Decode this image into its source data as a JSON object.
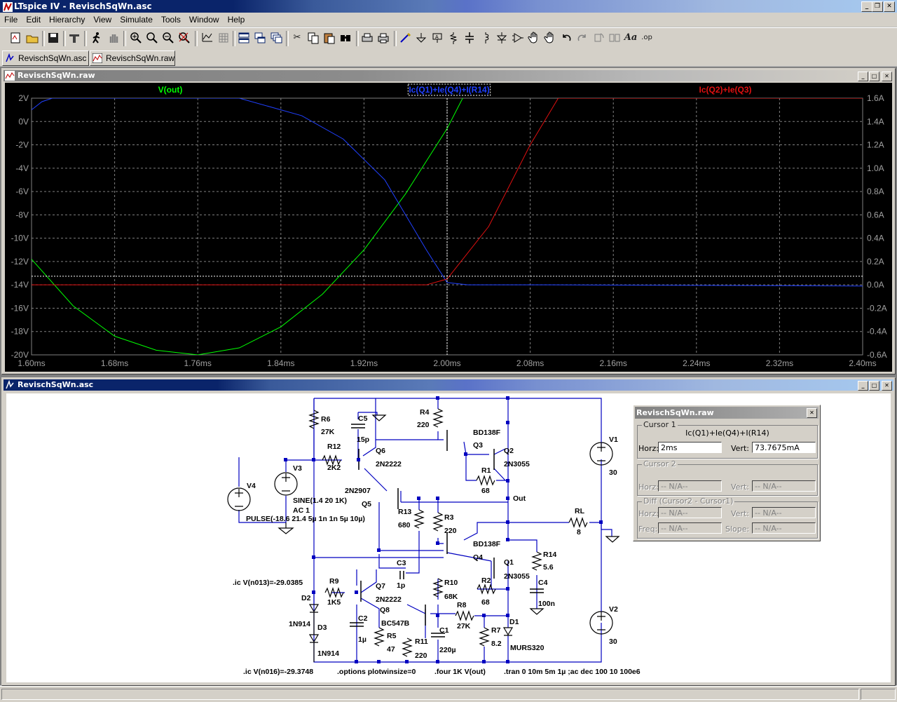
{
  "app": {
    "title": "LTspice IV - RevischSqWn.asc"
  },
  "menu": [
    "File",
    "Edit",
    "Hierarchy",
    "View",
    "Simulate",
    "Tools",
    "Window",
    "Help"
  ],
  "tabs": [
    {
      "label": "RevischSqWn.asc"
    },
    {
      "label": "RevischSqWn.raw"
    }
  ],
  "waveform_window": {
    "title": "RevischSqWn.raw"
  },
  "schematic_window": {
    "title": "RevischSqWn.asc"
  },
  "toolbar_icons": [
    "new-schematic-icon",
    "open-icon",
    "save-icon",
    "control-panel-icon",
    "run-icon",
    "halt-icon",
    "zoom-in-icon",
    "zoom-pan-icon",
    "zoom-out-icon",
    "zoom-fit-icon",
    "autorange-icon",
    "grid-icon",
    "tile-horizontal-icon",
    "tile-vertical-icon",
    "cascade-icon",
    "cut-icon",
    "copy-icon",
    "paste-icon",
    "find-icon",
    "print-setup-icon",
    "print-icon",
    "draw-wire-icon",
    "ground-icon",
    "label-net-icon",
    "resistor-icon",
    "capacitor-icon",
    "inductor-icon",
    "diode-icon",
    "component-icon",
    "move-icon",
    "drag-icon",
    "undo-icon",
    "redo-icon",
    "rotate-icon",
    "mirror-icon",
    "text-icon",
    "spice-directive-icon"
  ],
  "chart_data": {
    "type": "line",
    "x": [
      1.6,
      1.65,
      1.7,
      1.75,
      1.8,
      1.85,
      1.9,
      1.95,
      2.0,
      2.05,
      2.1,
      2.15,
      2.2,
      2.25,
      2.3,
      2.35,
      2.4
    ],
    "x_tick_labels": [
      "1.60ms",
      "1.68ms",
      "1.76ms",
      "1.84ms",
      "1.92ms",
      "2.00ms",
      "2.08ms",
      "2.16ms",
      "2.24ms",
      "2.32ms",
      "2.40ms"
    ],
    "left_axis": {
      "ylim": [
        -20,
        2
      ],
      "tick_labels": [
        "2V",
        "0V",
        "-2V",
        "-4V",
        "-6V",
        "-8V",
        "-10V",
        "-12V",
        "-14V",
        "-16V",
        "-18V",
        "-20V"
      ]
    },
    "right_axis": {
      "ylim": [
        -0.6,
        1.6
      ],
      "tick_labels": [
        "1.6A",
        "1.4A",
        "1.2A",
        "1.0A",
        "0.8A",
        "0.6A",
        "0.4A",
        "0.2A",
        "0.0A",
        "-0.2A",
        "-0.4A",
        "-0.6A"
      ]
    },
    "series": [
      {
        "name": "V(out)",
        "axis": "left",
        "color": "#00ff00",
        "x": [
          1.6,
          1.64,
          1.68,
          1.72,
          1.76,
          1.8,
          1.84,
          1.88,
          1.92,
          1.96,
          2.0,
          2.015
        ],
        "y": [
          -11.8,
          -15.8,
          -18.4,
          -19.6,
          -20.0,
          -19.4,
          -17.6,
          -14.8,
          -11.0,
          -6.2,
          -0.6,
          2.0
        ]
      },
      {
        "name": "Ic(Q1)+Ie(Q4)+I(R14)",
        "axis": "right",
        "color": "#2040ff",
        "x": [
          1.6,
          1.61,
          1.62,
          1.8,
          1.86,
          1.9,
          1.94,
          1.98,
          2.0,
          2.02,
          2.1,
          2.4
        ],
        "y": [
          1.5,
          1.57,
          1.6,
          1.6,
          1.45,
          1.25,
          0.9,
          0.3,
          0.02,
          0.0,
          0.0,
          -0.01
        ]
      },
      {
        "name": "Ic(Q2)+Ie(Q3)",
        "axis": "right",
        "color": "#e01010",
        "x": [
          1.6,
          1.9,
          1.98,
          2.0,
          2.04,
          2.08,
          2.107,
          2.4
        ],
        "y": [
          0.0,
          0.0,
          0.0,
          0.05,
          0.5,
          1.2,
          1.6,
          1.6
        ]
      }
    ],
    "cursor": {
      "x": 2.0,
      "y": 0.0737675
    }
  },
  "cursor_panel": {
    "title": "RevischSqWn.raw",
    "cursor1": {
      "label": "Cursor 1",
      "trace": "Ic(Q1)+Ie(Q4)+I(R14)",
      "horz_label": "Horz:",
      "horz": "2ms",
      "vert_label": "Vert:",
      "vert": "73.7675mA"
    },
    "cursor2": {
      "label": "Cursor 2",
      "horz_label": "Horz:",
      "horz": "-- N/A--",
      "vert_label": "Vert:",
      "vert": "-- N/A--"
    },
    "diff": {
      "label": "Diff (Cursor2 - Cursor1)",
      "horz_label": "Horz:",
      "horz": "-- N/A--",
      "vert_label": "Vert:",
      "vert": "-- N/A--",
      "freq_label": "Freq:",
      "freq": "-- N/A--",
      "slope_label": "Slope:",
      "slope": "-- N/A--"
    }
  },
  "schematic_labels": {
    "R6": "R6",
    "R6v": "27K",
    "C5": "C5",
    "C5v": "15p",
    "R4": "R4",
    "R4v": "220",
    "BD1": "BD138F",
    "Q3": "Q3",
    "Q2": "Q2",
    "Q2v": "2N3055",
    "R12": "R12",
    "R12v": "2K2",
    "Q6": "Q6",
    "Q6v": "2N2222",
    "R1": "R1",
    "R1v": "68",
    "V3": "V3",
    "V4": "V4",
    "sine": "SINE(1.4 20 1K)",
    "ac": "AC 1",
    "pulse": "PULSE(-18.6 21.4 5µ 1n 1n 5µ 10µ)",
    "Q5v": "2N2907",
    "Q5": "Q5",
    "R13": "R13",
    "R13v": "680",
    "R3": "R3",
    "R3v": "220",
    "out": "Out",
    "RL": "RL",
    "RLv": "8",
    "V1": "V1",
    "V1v": "30",
    "V2": "V2",
    "V2v": "30",
    "BD2": "BD138F",
    "Q4": "Q4",
    "Q1": "Q1",
    "Q1v": "2N3055",
    "R14": "R14",
    "R14v": "5.6",
    "C4": "C4",
    "C4v": "100n",
    "R2": "R2",
    "R2v": "68",
    "ic1": ".ic V(n013)=-29.0385",
    "R9": "R9",
    "R9v": "1K5",
    "C3": "C3",
    "C3v": "1p",
    "Q7": "Q7",
    "Q7v": "2N2222",
    "R10": "R10",
    "R10v": "68K",
    "D2": "D2",
    "D2v": "1N914",
    "D3": "D3",
    "D3v": "1N914",
    "Q8": "Q8",
    "Q8v": "BC547B",
    "C2": "C2",
    "C2v": "1µ",
    "R5": "R5",
    "R5v": "47",
    "R11": "R11",
    "R11v": "220",
    "C1": "C1",
    "C1v": "220µ",
    "R8": "R8",
    "R8v": "27K",
    "R7": "R7",
    "R7v": "8.2",
    "D1": "D1",
    "D1v": "MURS320",
    "ic2": ".ic V(n016)=-29.3748",
    "opt": ".options plotwinsize=0",
    "four": ".four 1K V(out)",
    "tran": ".tran 0 10m 5m 1µ  ;ac dec 100 10 100e6"
  }
}
